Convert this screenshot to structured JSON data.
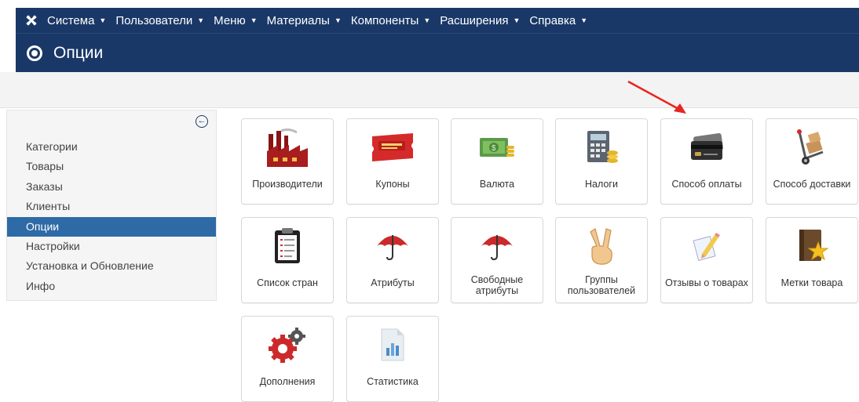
{
  "topbar": {
    "logo_icon": "joomla-logo-icon",
    "menu": [
      "Система",
      "Пользователи",
      "Меню",
      "Материалы",
      "Компоненты",
      "Расширения",
      "Справка"
    ]
  },
  "header": {
    "title": "Опции",
    "icon": "target-circle-icon"
  },
  "sidebar": {
    "collapse_icon": "arrow-left-circle-icon",
    "items": [
      "Категории",
      "Товары",
      "Заказы",
      "Клиенты",
      "Опции",
      "Настройки",
      "Установка и Обновление",
      "Инфо"
    ],
    "active_index": 4
  },
  "tiles": [
    {
      "label": "Производители",
      "icon": "factory-icon"
    },
    {
      "label": "Купоны",
      "icon": "coupon-ticket-icon"
    },
    {
      "label": "Валюта",
      "icon": "money-icon"
    },
    {
      "label": "Налоги",
      "icon": "calculator-icon"
    },
    {
      "label": "Способ оплаты",
      "icon": "credit-card-icon"
    },
    {
      "label": "Способ доставки",
      "icon": "hand-truck-icon"
    },
    {
      "label": "Список стран",
      "icon": "clipboard-list-icon"
    },
    {
      "label": "Атрибуты",
      "icon": "umbrella-icon"
    },
    {
      "label": "Свободные атрибуты",
      "icon": "umbrella-icon"
    },
    {
      "label": "Группы пользователей",
      "icon": "victory-hand-icon"
    },
    {
      "label": "Отзывы о товарах",
      "icon": "pencil-note-icon"
    },
    {
      "label": "Метки товара",
      "icon": "star-book-icon"
    },
    {
      "label": "Дополнения",
      "icon": "gears-icon"
    },
    {
      "label": "Статистика",
      "icon": "chart-document-icon"
    }
  ],
  "colors": {
    "navbar": "#1a3867",
    "active": "#2e6aa6",
    "annotation_arrow": "#e8251f"
  }
}
